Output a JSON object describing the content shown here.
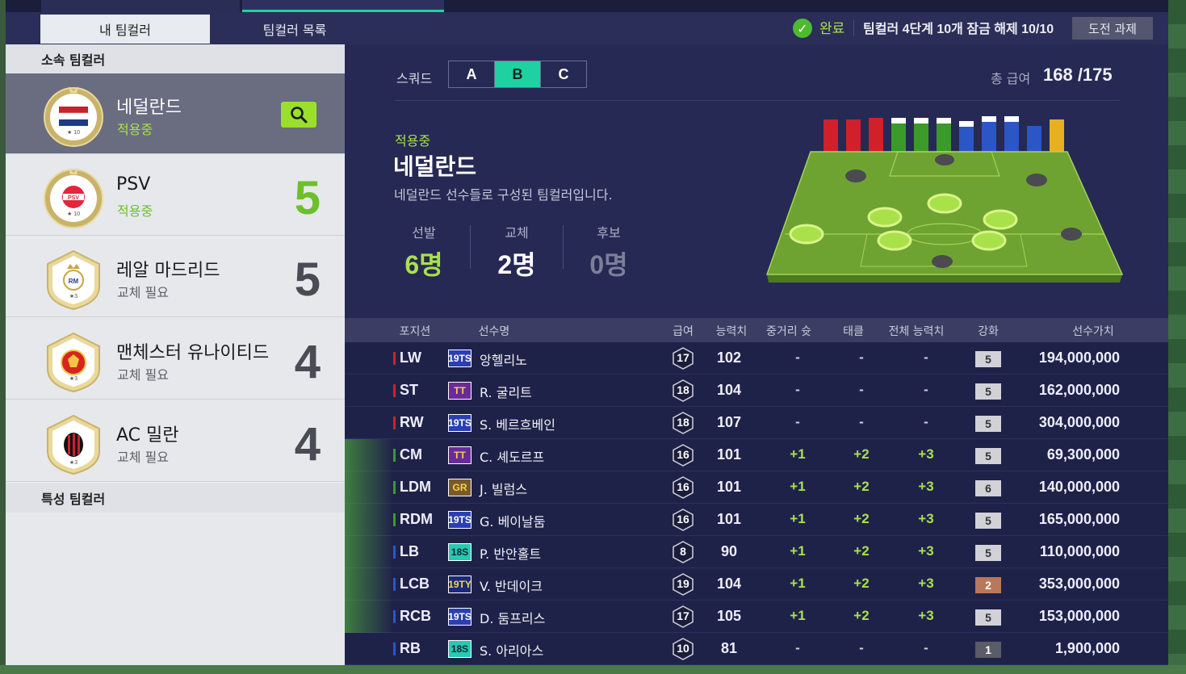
{
  "tabs": {
    "my_teamcolor": "내 팀컬러",
    "teamcolor_list": "팀컬러 목록"
  },
  "mission": {
    "status": "완료",
    "text": "팀컬러 4단계 10개 잠금 해제 10/10",
    "button": "도전 과제"
  },
  "left": {
    "affiliated_header": "소속 팀컬러",
    "special_header": "특성 팀컬러",
    "clubs": [
      {
        "name": "네덜란드",
        "status": "적용중"
      },
      {
        "name": "PSV",
        "status": "적용중",
        "count": "5"
      },
      {
        "name": "레알 마드리드",
        "status": "교체 필요",
        "count": "5"
      },
      {
        "name": "맨체스터 유나이티드",
        "status": "교체 필요",
        "count": "4"
      },
      {
        "name": "AC 밀란",
        "status": "교체 필요",
        "count": "4"
      }
    ]
  },
  "squad": {
    "label": "스쿼드",
    "options": [
      "A",
      "B",
      "C"
    ],
    "selected": "B"
  },
  "salary": {
    "label": "총 급여",
    "value": "168 /175"
  },
  "detail": {
    "status": "적용중",
    "name": "네덜란드",
    "description": "네덜란드 선수들로 구성된 팀컬러입니다.",
    "starting_label": "선발",
    "starting_value": "6명",
    "sub_label": "교체",
    "sub_value": "2명",
    "reserve_label": "후보",
    "reserve_value": "0명"
  },
  "table": {
    "headers": {
      "position": "포지션",
      "name": "선수명",
      "pay": "급여",
      "ovr": "능력치",
      "long_shot": "중거리 슛",
      "tackle": "태클",
      "overall": "전체 능력치",
      "enhance": "강화",
      "value": "선수가치"
    },
    "rows": [
      {
        "pos": "LW",
        "season": "19TS",
        "name": "앙헬리노",
        "pay": "17",
        "ovr": "102",
        "long_shot": "-",
        "tackle": "-",
        "overall": "-",
        "enhance": "5",
        "value": "194,000,000"
      },
      {
        "pos": "ST",
        "season": "TT",
        "name": "R. 굴리트",
        "pay": "18",
        "ovr": "104",
        "long_shot": "-",
        "tackle": "-",
        "overall": "-",
        "enhance": "5",
        "value": "162,000,000"
      },
      {
        "pos": "RW",
        "season": "19TS",
        "name": "S. 베르흐베인",
        "pay": "18",
        "ovr": "107",
        "long_shot": "-",
        "tackle": "-",
        "overall": "-",
        "enhance": "5",
        "value": "304,000,000"
      },
      {
        "pos": "CM",
        "season": "TT",
        "name": "C. 셰도르프",
        "pay": "16",
        "ovr": "101",
        "long_shot": "+1",
        "tackle": "+2",
        "overall": "+3",
        "enhance": "5",
        "value": "69,300,000"
      },
      {
        "pos": "LDM",
        "season": "GR",
        "name": "J. 빌럼스",
        "pay": "16",
        "ovr": "101",
        "long_shot": "+1",
        "tackle": "+2",
        "overall": "+3",
        "enhance": "6",
        "value": "140,000,000"
      },
      {
        "pos": "RDM",
        "season": "19TS",
        "name": "G. 베이날둠",
        "pay": "16",
        "ovr": "101",
        "long_shot": "+1",
        "tackle": "+2",
        "overall": "+3",
        "enhance": "5",
        "value": "165,000,000"
      },
      {
        "pos": "LB",
        "season": "18S",
        "name": "P. 반안홀트",
        "pay": "8",
        "ovr": "90",
        "long_shot": "+1",
        "tackle": "+2",
        "overall": "+3",
        "enhance": "5",
        "value": "110,000,000"
      },
      {
        "pos": "LCB",
        "season": "19TY",
        "name": "V. 반데이크",
        "pay": "19",
        "ovr": "104",
        "long_shot": "+1",
        "tackle": "+2",
        "overall": "+3",
        "enhance": "2",
        "value": "353,000,000"
      },
      {
        "pos": "RCB",
        "season": "19TS",
        "name": "D. 둠프리스",
        "pay": "17",
        "ovr": "105",
        "long_shot": "+1",
        "tackle": "+2",
        "overall": "+3",
        "enhance": "5",
        "value": "153,000,000"
      },
      {
        "pos": "RB",
        "season": "18S",
        "name": "S. 아리아스",
        "pay": "10",
        "ovr": "81",
        "long_shot": "-",
        "tackle": "-",
        "overall": "-",
        "enhance": "1",
        "value": "1,900,000"
      }
    ]
  },
  "colors": {
    "accent": "#1fd1a1",
    "applied_green": "#a9e14b",
    "panel_bg": "#22244a"
  }
}
